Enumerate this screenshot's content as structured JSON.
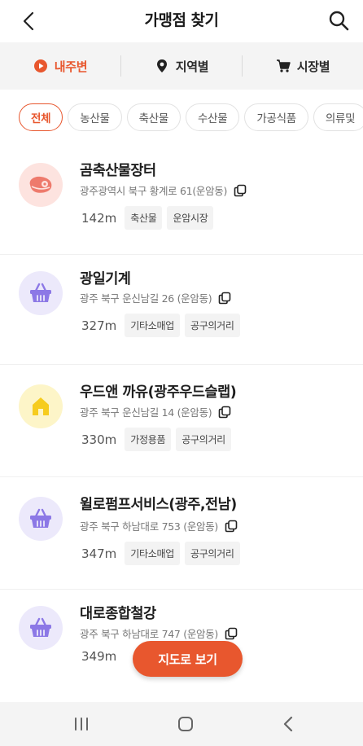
{
  "header": {
    "title": "가맹점 찾기"
  },
  "segments": [
    {
      "label": "내주변",
      "active": true
    },
    {
      "label": "지역별",
      "active": false
    },
    {
      "label": "시장별",
      "active": false
    }
  ],
  "chips": [
    "전체",
    "농산물",
    "축산물",
    "수산물",
    "가공식품",
    "의류및"
  ],
  "stores": [
    {
      "name": "곰축산물장터",
      "address": "광주광역시 북구 황계로 61(운암동)",
      "distance": "142m",
      "tags": [
        "축산물",
        "운암시장"
      ],
      "icon": "meat-icon"
    },
    {
      "name": "광일기계",
      "address": "광주 북구 운신남길 26 (운암동)",
      "distance": "327m",
      "tags": [
        "기타소매업",
        "공구의거리"
      ],
      "icon": "basket-icon"
    },
    {
      "name": "우드앤 까유(광주우드슬랩)",
      "address": "광주 북구 운신남길 14 (운암동)",
      "distance": "330m",
      "tags": [
        "가정용품",
        "공구의거리"
      ],
      "icon": "house-icon"
    },
    {
      "name": "윌로펌프서비스(광주,전남)",
      "address": "광주 북구 하남대로 753 (운암동)",
      "distance": "347m",
      "tags": [
        "기타소매업",
        "공구의거리"
      ],
      "icon": "basket-icon"
    },
    {
      "name": "대로종합철강",
      "address": "광주 북구 하남대로 747 (운암동)",
      "distance": "349m",
      "tags": [],
      "icon": "basket-icon"
    }
  ],
  "map_button": {
    "label": "지도로 보기"
  },
  "colors": {
    "accent": "#e8572e",
    "meat_bg": "#fde3df",
    "basket_bg": "#ece9fb",
    "house_bg": "#fdf5c8"
  }
}
